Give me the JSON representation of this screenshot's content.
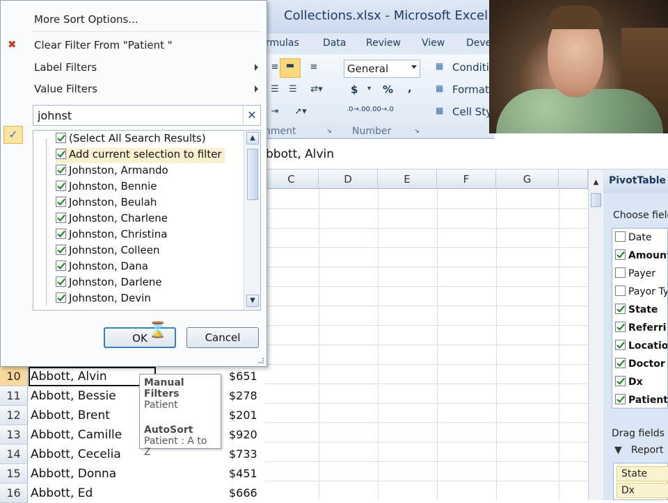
{
  "window": {
    "title": "Collections.xlsx  -  Microsoft Excel"
  },
  "ribbon": {
    "tabs": [
      "rmulas",
      "Data",
      "Review",
      "View",
      "Deve"
    ],
    "number_format": "General",
    "currency": "$",
    "percent": "%",
    "comma": ",",
    "increase_decimal": ".0→.00",
    "decrease_decimal": ".00→.0",
    "styles": {
      "conditional": "Conditi",
      "format_as_table": "Format",
      "cell_styles": "Cell Sty"
    },
    "groups": {
      "alignment": "nment",
      "number": "Number"
    }
  },
  "formula_bar": {
    "value": "bbott, Alvin"
  },
  "grid": {
    "columns": [
      "C",
      "D",
      "E",
      "F",
      "G"
    ],
    "rows": [
      {
        "num": "10",
        "name": "Abbott, Alvin",
        "amount": "$651",
        "selected": true
      },
      {
        "num": "11",
        "name": "Abbott, Bessie",
        "amount": "$278"
      },
      {
        "num": "12",
        "name": "Abbott, Brent",
        "amount": "$201"
      },
      {
        "num": "13",
        "name": "Abbott, Camille",
        "amount": "$920"
      },
      {
        "num": "14",
        "name": "Abbott, Cecelia",
        "amount": "$733"
      },
      {
        "num": "15",
        "name": "Abbott, Donna",
        "amount": "$451"
      },
      {
        "num": "16",
        "name": "Abbott, Ed",
        "amount": "$666"
      }
    ]
  },
  "tooltip": {
    "manual_filters_heading": "Manual Filters",
    "manual_filters_value": "Patient",
    "autosort_heading": "AutoSort",
    "autosort_value": "Patient : A to Z"
  },
  "filter_menu": {
    "more_sort_options": "More Sort Options...",
    "clear_filter": "Clear Filter From \"Patient \"",
    "label_filters": "Label Filters",
    "value_filters": "Value Filters",
    "search_value": "johnst",
    "search_clear": "✕",
    "items": [
      {
        "label": "(Select All Search Results)",
        "checked": true
      },
      {
        "label": "Add current selection to filter",
        "checked": true,
        "highlight": true
      },
      {
        "label": "Johnston, Armando",
        "checked": true
      },
      {
        "label": "Johnston, Bennie",
        "checked": true
      },
      {
        "label": "Johnston, Beulah",
        "checked": true
      },
      {
        "label": "Johnston, Charlene",
        "checked": true
      },
      {
        "label": "Johnston, Christina",
        "checked": true
      },
      {
        "label": "Johnston, Colleen",
        "checked": true
      },
      {
        "label": "Johnston, Dana",
        "checked": true
      },
      {
        "label": "Johnston, Darlene",
        "checked": true
      },
      {
        "label": "Johnston, Devin",
        "checked": true
      }
    ],
    "ok_label": "OK",
    "cancel_label": "Cancel"
  },
  "pivot": {
    "title": "PivotTable",
    "choose_label": "Choose field",
    "fields": [
      {
        "label": "Date",
        "checked": false,
        "bold": false
      },
      {
        "label": "Amount",
        "checked": true,
        "bold": true
      },
      {
        "label": "Payer",
        "checked": false,
        "bold": false
      },
      {
        "label": "Payor Ty",
        "checked": false,
        "bold": false
      },
      {
        "label": "State",
        "checked": true,
        "bold": true
      },
      {
        "label": "Referri",
        "checked": true,
        "bold": true
      },
      {
        "label": "Location",
        "checked": true,
        "bold": true
      },
      {
        "label": "Doctor",
        "checked": true,
        "bold": true
      },
      {
        "label": "Dx",
        "checked": true,
        "bold": true
      },
      {
        "label": "Patient",
        "checked": true,
        "bold": true
      }
    ],
    "drag_label": "Drag fields b",
    "report_filter_label": "Report",
    "report_filter_items": [
      "State",
      "Dx"
    ]
  },
  "colors": {
    "accent": "#1e395b",
    "selected_row": "#f9d99b",
    "highlight": "#fbf0d0"
  }
}
